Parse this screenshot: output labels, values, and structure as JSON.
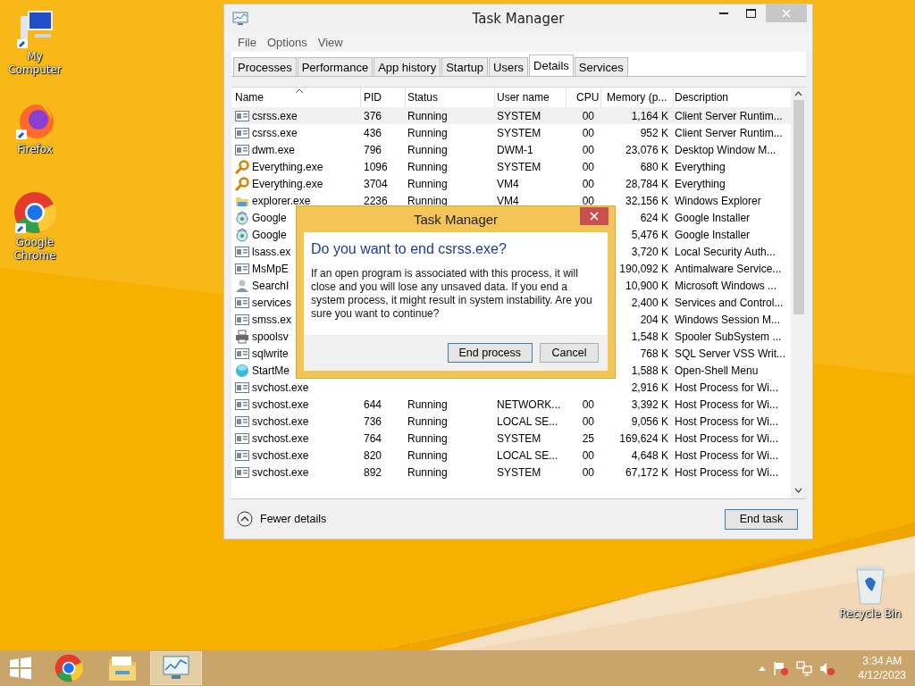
{
  "desktop_icons": [
    {
      "label": "My Computer"
    },
    {
      "label": "Firefox"
    },
    {
      "label": "Google Chrome"
    },
    {
      "label": "Recycle Bin"
    }
  ],
  "task_manager": {
    "title": "Task Manager",
    "menu": [
      "File",
      "Options",
      "View"
    ],
    "tabs": [
      {
        "label": "Processes",
        "selected": false
      },
      {
        "label": "Performance",
        "selected": false
      },
      {
        "label": "App history",
        "selected": false
      },
      {
        "label": "Startup",
        "selected": false
      },
      {
        "label": "Users",
        "selected": false
      },
      {
        "label": "Details",
        "selected": true
      },
      {
        "label": "Services",
        "selected": false
      }
    ],
    "columns": [
      {
        "label": "Name",
        "sorted": true
      },
      {
        "label": "PID",
        "sorted": false
      },
      {
        "label": "Status",
        "sorted": false
      },
      {
        "label": "User name",
        "sorted": false
      },
      {
        "label": "CPU",
        "sorted": false
      },
      {
        "label": "Memory (p...",
        "sorted": false
      },
      {
        "label": "Description",
        "sorted": false
      }
    ],
    "rows": [
      {
        "kind": "window",
        "name": "csrss.exe",
        "pid": "376",
        "status": "Running",
        "user": "SYSTEM",
        "cpu": "00",
        "memory": "1,164 K",
        "description": "Client Server Runtim...",
        "selected": true
      },
      {
        "kind": "window",
        "name": "csrss.exe",
        "pid": "436",
        "status": "Running",
        "user": "SYSTEM",
        "cpu": "00",
        "memory": "952 K",
        "description": "Client Server Runtim...",
        "selected": false
      },
      {
        "kind": "window",
        "name": "dwm.exe",
        "pid": "796",
        "status": "Running",
        "user": "DWM-1",
        "cpu": "00",
        "memory": "23,076 K",
        "description": "Desktop Window M...",
        "selected": false
      },
      {
        "kind": "magnifier",
        "name": "Everything.exe",
        "pid": "1096",
        "status": "Running",
        "user": "SYSTEM",
        "cpu": "00",
        "memory": "680 K",
        "description": "Everything",
        "selected": false
      },
      {
        "kind": "magnifier",
        "name": "Everything.exe",
        "pid": "3704",
        "status": "Running",
        "user": "VM4",
        "cpu": "00",
        "memory": "28,784 K",
        "description": "Everything",
        "selected": false
      },
      {
        "kind": "folder",
        "name": "explorer.exe",
        "pid": "2236",
        "status": "Running",
        "user": "VM4",
        "cpu": "00",
        "memory": "32,156 K",
        "description": "Windows Explorer",
        "selected": false
      },
      {
        "kind": "installer",
        "name": "Google",
        "memory": "624 K",
        "description": "Google Installer",
        "selected": false
      },
      {
        "kind": "installer",
        "name": "Google",
        "memory": "5,476 K",
        "description": "Google Installer",
        "selected": false
      },
      {
        "kind": "window",
        "name": "lsass.ex",
        "memory": "3,720 K",
        "description": "Local Security Auth...",
        "selected": false
      },
      {
        "kind": "window",
        "name": "MsMpE",
        "memory": "190,092 K",
        "description": "Antimalware Service...",
        "selected": false
      },
      {
        "kind": "user",
        "name": "SearchI",
        "memory": "10,900 K",
        "description": "Microsoft Windows ...",
        "selected": false
      },
      {
        "kind": "window",
        "name": "services",
        "memory": "2,400 K",
        "description": "Services and Control...",
        "selected": false
      },
      {
        "kind": "window",
        "name": "smss.ex",
        "memory": "204 K",
        "description": "Windows Session M...",
        "selected": false
      },
      {
        "kind": "printer",
        "name": "spoolsv",
        "memory": "1,548 K",
        "description": "Spooler SubSystem ...",
        "selected": false
      },
      {
        "kind": "window",
        "name": "sqlwrite",
        "memory": "768 K",
        "description": "SQL Server VSS Writ...",
        "selected": false
      },
      {
        "kind": "globe",
        "name": "StartMe",
        "memory": "1,588 K",
        "description": "Open-Shell Menu",
        "selected": false
      },
      {
        "kind": "window",
        "name": "svchost.exe",
        "memory": "2,916 K",
        "description": "Host Process for Wi...",
        "selected": false
      },
      {
        "kind": "window",
        "name": "svchost.exe",
        "pid": "644",
        "status": "Running",
        "user": "NETWORK...",
        "cpu": "00",
        "memory": "3,392 K",
        "description": "Host Process for Wi...",
        "selected": false
      },
      {
        "kind": "window",
        "name": "svchost.exe",
        "pid": "736",
        "status": "Running",
        "user": "LOCAL SE...",
        "cpu": "00",
        "memory": "9,056 K",
        "description": "Host Process for Wi...",
        "selected": false
      },
      {
        "kind": "window",
        "name": "svchost.exe",
        "pid": "764",
        "status": "Running",
        "user": "SYSTEM",
        "cpu": "25",
        "memory": "169,624 K",
        "description": "Host Process for Wi...",
        "selected": false
      },
      {
        "kind": "window",
        "name": "svchost.exe",
        "pid": "820",
        "status": "Running",
        "user": "LOCAL SE...",
        "cpu": "00",
        "memory": "4,648 K",
        "description": "Host Process for Wi...",
        "selected": false
      },
      {
        "kind": "window",
        "name": "svchost.exe",
        "pid": "892",
        "status": "Running",
        "user": "SYSTEM",
        "cpu": "00",
        "memory": "67,172 K",
        "description": "Host Process for Wi...",
        "selected": false
      }
    ],
    "fewer_details": "Fewer details",
    "end_task": "End task"
  },
  "dialog": {
    "title": "Task Manager",
    "heading": "Do you want to end csrss.exe?",
    "message": "If an open program is associated with this process, it will close and you will lose any unsaved data. If you end a system process, it might result in system instability. Are you sure you want to continue?",
    "buttons": [
      {
        "label": "End process",
        "default": true
      },
      {
        "label": "Cancel",
        "default": false
      }
    ]
  },
  "taskbar": {
    "apps": [
      {
        "active": false
      },
      {
        "active": false
      },
      {
        "active": true
      }
    ],
    "time": "3:34 AM",
    "date": "4/12/2023"
  }
}
